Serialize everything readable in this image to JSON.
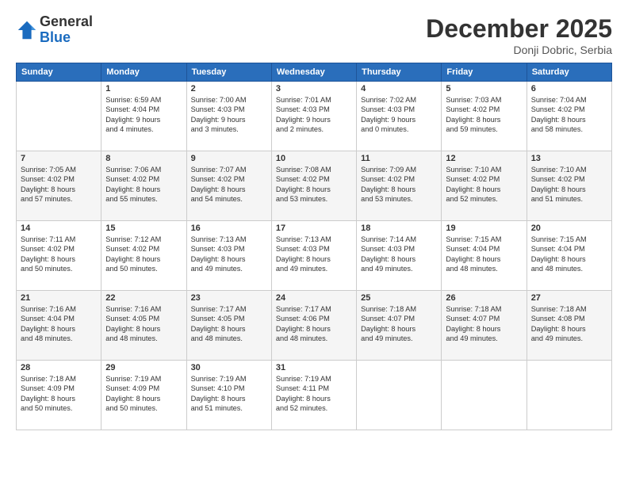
{
  "header": {
    "logo_general": "General",
    "logo_blue": "Blue",
    "month": "December 2025",
    "location": "Donji Dobric, Serbia"
  },
  "columns": [
    "Sunday",
    "Monday",
    "Tuesday",
    "Wednesday",
    "Thursday",
    "Friday",
    "Saturday"
  ],
  "weeks": [
    [
      {
        "day": "",
        "info": ""
      },
      {
        "day": "1",
        "info": "Sunrise: 6:59 AM\nSunset: 4:04 PM\nDaylight: 9 hours\nand 4 minutes."
      },
      {
        "day": "2",
        "info": "Sunrise: 7:00 AM\nSunset: 4:03 PM\nDaylight: 9 hours\nand 3 minutes."
      },
      {
        "day": "3",
        "info": "Sunrise: 7:01 AM\nSunset: 4:03 PM\nDaylight: 9 hours\nand 2 minutes."
      },
      {
        "day": "4",
        "info": "Sunrise: 7:02 AM\nSunset: 4:03 PM\nDaylight: 9 hours\nand 0 minutes."
      },
      {
        "day": "5",
        "info": "Sunrise: 7:03 AM\nSunset: 4:02 PM\nDaylight: 8 hours\nand 59 minutes."
      },
      {
        "day": "6",
        "info": "Sunrise: 7:04 AM\nSunset: 4:02 PM\nDaylight: 8 hours\nand 58 minutes."
      }
    ],
    [
      {
        "day": "7",
        "info": "Sunrise: 7:05 AM\nSunset: 4:02 PM\nDaylight: 8 hours\nand 57 minutes."
      },
      {
        "day": "8",
        "info": "Sunrise: 7:06 AM\nSunset: 4:02 PM\nDaylight: 8 hours\nand 55 minutes."
      },
      {
        "day": "9",
        "info": "Sunrise: 7:07 AM\nSunset: 4:02 PM\nDaylight: 8 hours\nand 54 minutes."
      },
      {
        "day": "10",
        "info": "Sunrise: 7:08 AM\nSunset: 4:02 PM\nDaylight: 8 hours\nand 53 minutes."
      },
      {
        "day": "11",
        "info": "Sunrise: 7:09 AM\nSunset: 4:02 PM\nDaylight: 8 hours\nand 53 minutes."
      },
      {
        "day": "12",
        "info": "Sunrise: 7:10 AM\nSunset: 4:02 PM\nDaylight: 8 hours\nand 52 minutes."
      },
      {
        "day": "13",
        "info": "Sunrise: 7:10 AM\nSunset: 4:02 PM\nDaylight: 8 hours\nand 51 minutes."
      }
    ],
    [
      {
        "day": "14",
        "info": "Sunrise: 7:11 AM\nSunset: 4:02 PM\nDaylight: 8 hours\nand 50 minutes."
      },
      {
        "day": "15",
        "info": "Sunrise: 7:12 AM\nSunset: 4:02 PM\nDaylight: 8 hours\nand 50 minutes."
      },
      {
        "day": "16",
        "info": "Sunrise: 7:13 AM\nSunset: 4:03 PM\nDaylight: 8 hours\nand 49 minutes."
      },
      {
        "day": "17",
        "info": "Sunrise: 7:13 AM\nSunset: 4:03 PM\nDaylight: 8 hours\nand 49 minutes."
      },
      {
        "day": "18",
        "info": "Sunrise: 7:14 AM\nSunset: 4:03 PM\nDaylight: 8 hours\nand 49 minutes."
      },
      {
        "day": "19",
        "info": "Sunrise: 7:15 AM\nSunset: 4:04 PM\nDaylight: 8 hours\nand 48 minutes."
      },
      {
        "day": "20",
        "info": "Sunrise: 7:15 AM\nSunset: 4:04 PM\nDaylight: 8 hours\nand 48 minutes."
      }
    ],
    [
      {
        "day": "21",
        "info": "Sunrise: 7:16 AM\nSunset: 4:04 PM\nDaylight: 8 hours\nand 48 minutes."
      },
      {
        "day": "22",
        "info": "Sunrise: 7:16 AM\nSunset: 4:05 PM\nDaylight: 8 hours\nand 48 minutes."
      },
      {
        "day": "23",
        "info": "Sunrise: 7:17 AM\nSunset: 4:05 PM\nDaylight: 8 hours\nand 48 minutes."
      },
      {
        "day": "24",
        "info": "Sunrise: 7:17 AM\nSunset: 4:06 PM\nDaylight: 8 hours\nand 48 minutes."
      },
      {
        "day": "25",
        "info": "Sunrise: 7:18 AM\nSunset: 4:07 PM\nDaylight: 8 hours\nand 49 minutes."
      },
      {
        "day": "26",
        "info": "Sunrise: 7:18 AM\nSunset: 4:07 PM\nDaylight: 8 hours\nand 49 minutes."
      },
      {
        "day": "27",
        "info": "Sunrise: 7:18 AM\nSunset: 4:08 PM\nDaylight: 8 hours\nand 49 minutes."
      }
    ],
    [
      {
        "day": "28",
        "info": "Sunrise: 7:18 AM\nSunset: 4:09 PM\nDaylight: 8 hours\nand 50 minutes."
      },
      {
        "day": "29",
        "info": "Sunrise: 7:19 AM\nSunset: 4:09 PM\nDaylight: 8 hours\nand 50 minutes."
      },
      {
        "day": "30",
        "info": "Sunrise: 7:19 AM\nSunset: 4:10 PM\nDaylight: 8 hours\nand 51 minutes."
      },
      {
        "day": "31",
        "info": "Sunrise: 7:19 AM\nSunset: 4:11 PM\nDaylight: 8 hours\nand 52 minutes."
      },
      {
        "day": "",
        "info": ""
      },
      {
        "day": "",
        "info": ""
      },
      {
        "day": "",
        "info": ""
      }
    ]
  ]
}
